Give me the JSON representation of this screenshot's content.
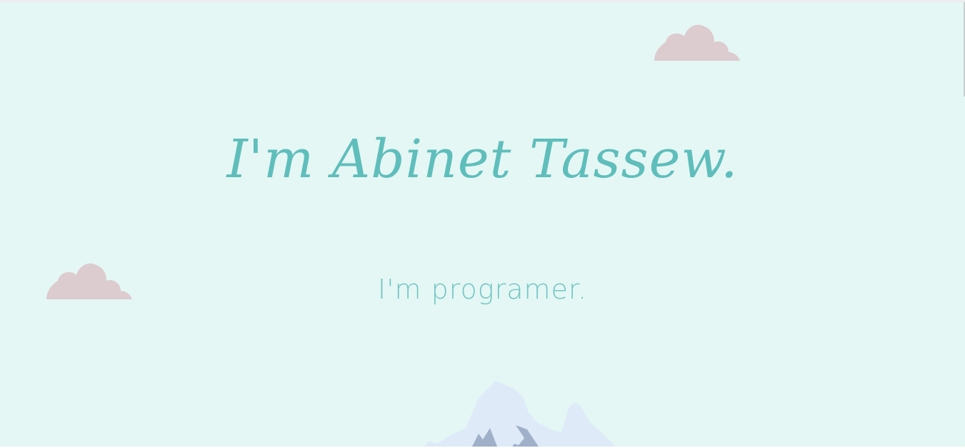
{
  "hero": {
    "title": "I'm Abinet Tassew.",
    "subtitle": "I'm programer."
  },
  "colors": {
    "background": "#e4f7f4",
    "accent": "#5fbebc",
    "subtitle": "#74c6c4",
    "cloud": "#dccbcf",
    "mountain_light": "#dfeaf8",
    "mountain_dark": "#9fb0c8"
  },
  "decorations": {
    "cloud_icon": "cloud-icon",
    "mountain_icon": "mountain-icon"
  }
}
